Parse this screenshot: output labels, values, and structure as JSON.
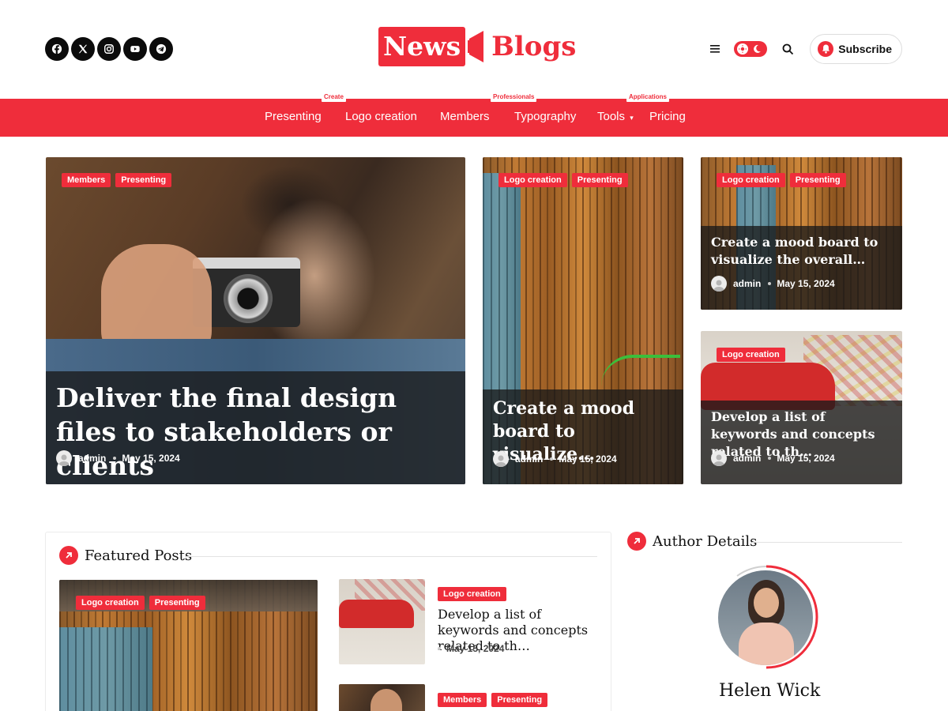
{
  "header": {
    "social_icons": [
      "facebook-icon",
      "x-icon",
      "instagram-icon",
      "youtube-icon",
      "telegram-icon"
    ],
    "logo": {
      "part1": "News",
      "part2": "Blogs"
    },
    "subscribe_label": "Subscribe"
  },
  "colors": {
    "accent": "#ef2d3b",
    "dark": "#0b0b0b"
  },
  "nav": {
    "items": [
      {
        "label": "Presenting"
      },
      {
        "label": "Logo creation",
        "badge": "Create"
      },
      {
        "label": "Members"
      },
      {
        "label": "Typography",
        "badge": "Professionals"
      },
      {
        "label": "Tools"
      },
      {
        "label": "Pricing",
        "badge": "Applications"
      }
    ]
  },
  "hero": {
    "main": {
      "categories": [
        "Members",
        "Presenting"
      ],
      "title": "Deliver the final design files to stakeholders or clients",
      "author": "admin",
      "date": "May 15, 2024"
    },
    "middle": {
      "categories": [
        "Logo creation",
        "Presenting"
      ],
      "title": "Create a mood board to visualize…",
      "author": "admin",
      "date": "May 15, 2024"
    },
    "right_top": {
      "categories": [
        "Logo creation",
        "Presenting"
      ],
      "title": "Create a mood board to visualize the overall…",
      "author": "admin",
      "date": "May 15, 2024"
    },
    "right_bottom": {
      "categories": [
        "Logo creation"
      ],
      "title": "Develop a list of keywords and concepts related to th…",
      "author": "admin",
      "date": "May 15, 2024"
    }
  },
  "featured": {
    "heading": "Featured Posts",
    "big": {
      "categories": [
        "Logo creation",
        "Presenting"
      ]
    },
    "list": [
      {
        "categories": [
          "Logo creation"
        ],
        "title": "Develop a list of keywords and concepts related to th…",
        "date": "May 15, 2024"
      },
      {
        "categories": [
          "Members",
          "Presenting"
        ]
      }
    ]
  },
  "author_details": {
    "heading": "Author Details",
    "name": "Helen Wick"
  }
}
